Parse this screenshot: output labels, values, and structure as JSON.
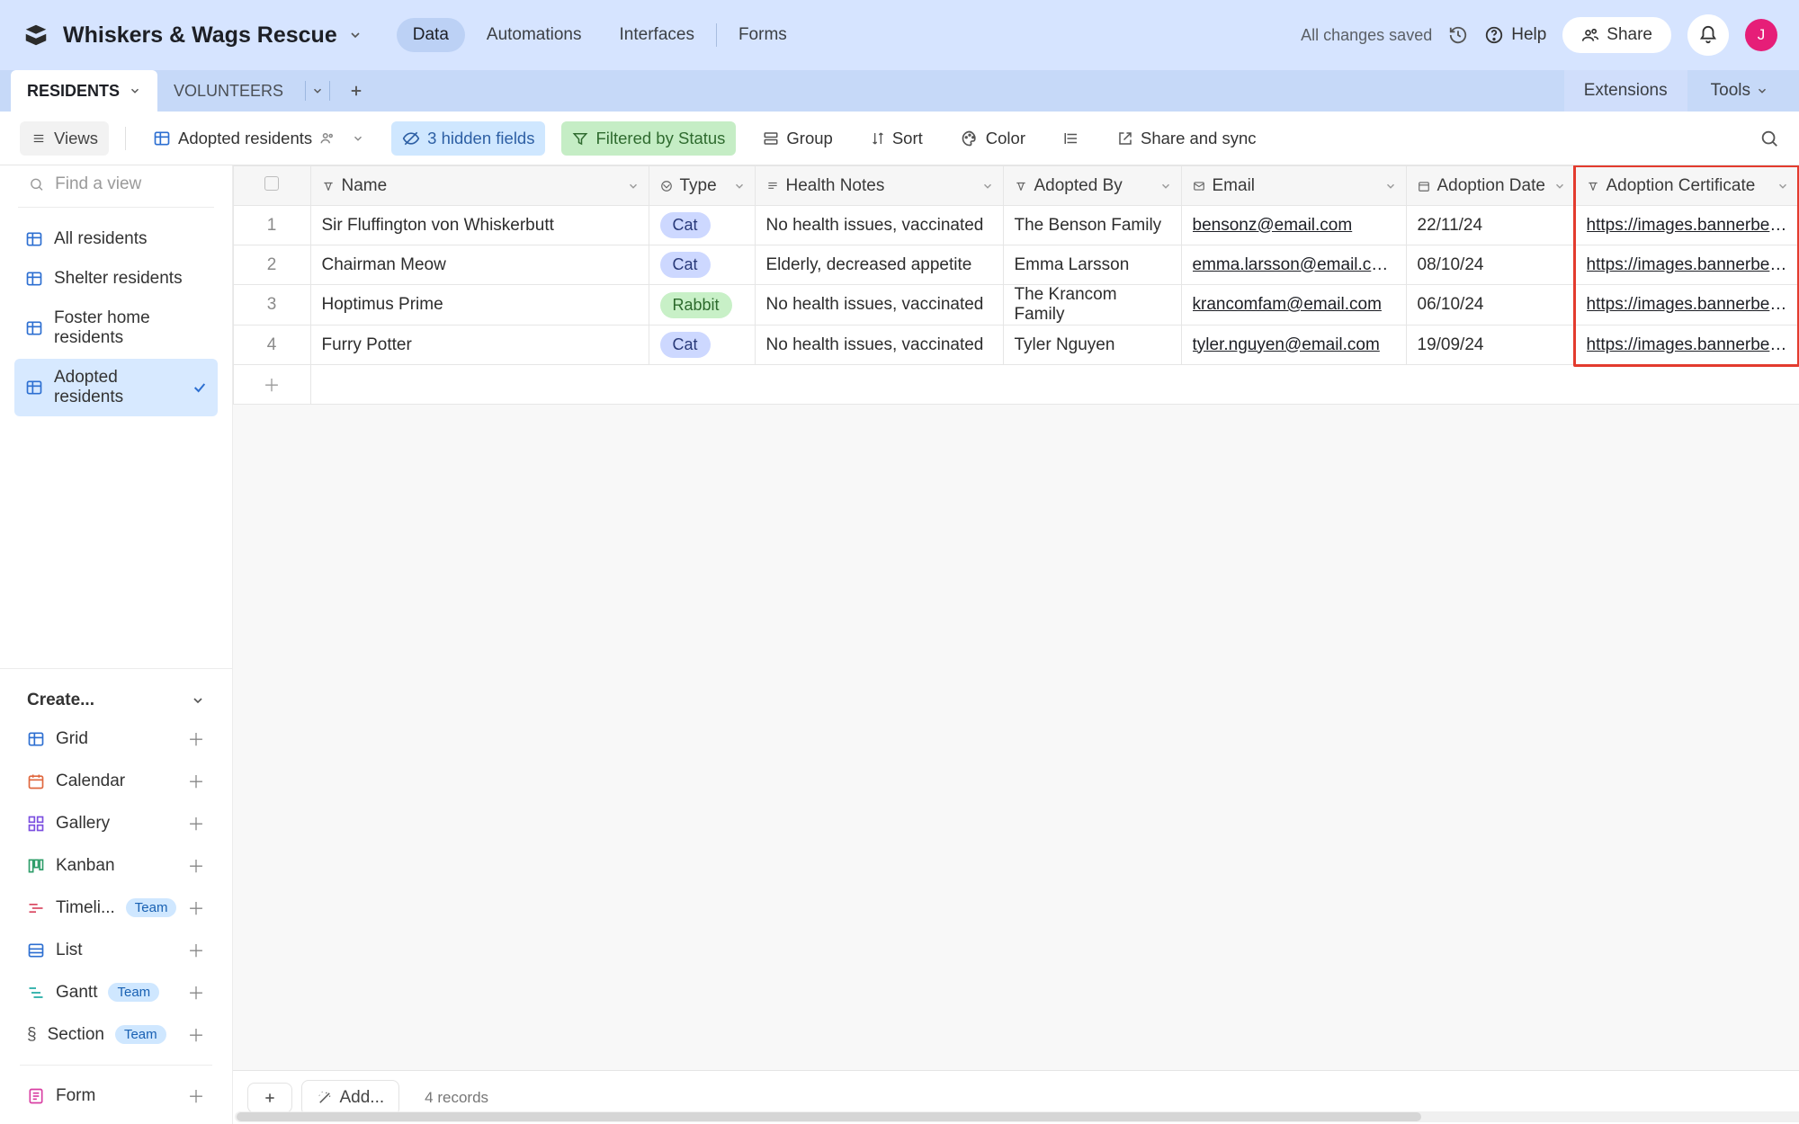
{
  "header": {
    "base_name": "Whiskers & Wags Rescue",
    "tabs": {
      "data": "Data",
      "automations": "Automations",
      "interfaces": "Interfaces",
      "forms": "Forms"
    },
    "saved_text": "All changes saved",
    "help": "Help",
    "share": "Share",
    "avatar_initial": "J"
  },
  "tables": {
    "residents": "RESIDENTS",
    "volunteers": "VOLUNTEERS",
    "extensions": "Extensions",
    "tools": "Tools"
  },
  "toolbar": {
    "views": "Views",
    "current_view": "Adopted residents",
    "hidden_fields": "3 hidden fields",
    "filtered": "Filtered by Status",
    "group": "Group",
    "sort": "Sort",
    "color": "Color",
    "share_sync": "Share and sync"
  },
  "sidebar": {
    "find_placeholder": "Find a view",
    "views": [
      {
        "label": "All residents"
      },
      {
        "label": "Shelter residents"
      },
      {
        "label": "Foster home residents"
      },
      {
        "label": "Adopted residents"
      }
    ],
    "create_label": "Create...",
    "create_items": {
      "grid": "Grid",
      "calendar": "Calendar",
      "gallery": "Gallery",
      "kanban": "Kanban",
      "timeline": "Timeli...",
      "list": "List",
      "gantt": "Gantt",
      "section": "Section",
      "form": "Form"
    },
    "team_badge": "Team"
  },
  "grid": {
    "columns": {
      "name": "Name",
      "type": "Type",
      "health": "Health Notes",
      "adopted_by": "Adopted By",
      "email": "Email",
      "adoption_date": "Adoption Date",
      "adoption_cert": "Adoption Certificate"
    },
    "rows": [
      {
        "num": "1",
        "name": "Sir Fluffington von Whiskerbutt",
        "type": "Cat",
        "health": "No health issues, vaccinated",
        "adopted_by": "The Benson Family",
        "email": "bensonz@email.com",
        "date": "22/11/24",
        "cert": "https://images.bannerbea..."
      },
      {
        "num": "2",
        "name": "Chairman Meow",
        "type": "Cat",
        "health": "Elderly, decreased appetite",
        "adopted_by": "Emma Larsson",
        "email": "emma.larsson@email.com",
        "date": "08/10/24",
        "cert": "https://images.bannerbea..."
      },
      {
        "num": "3",
        "name": "Hoptimus Prime",
        "type": "Rabbit",
        "health": "No health issues, vaccinated",
        "adopted_by": "The Krancom Family",
        "email": "krancomfam@email.com",
        "date": "06/10/24",
        "cert": "https://images.bannerbea..."
      },
      {
        "num": "4",
        "name": "Furry Potter",
        "type": "Cat",
        "health": "No health issues, vaccinated",
        "adopted_by": "Tyler Nguyen",
        "email": "tyler.nguyen@email.com",
        "date": "19/09/24",
        "cert": "https://images.bannerbea..."
      }
    ]
  },
  "footer": {
    "add": "Add...",
    "records": "4 records"
  }
}
